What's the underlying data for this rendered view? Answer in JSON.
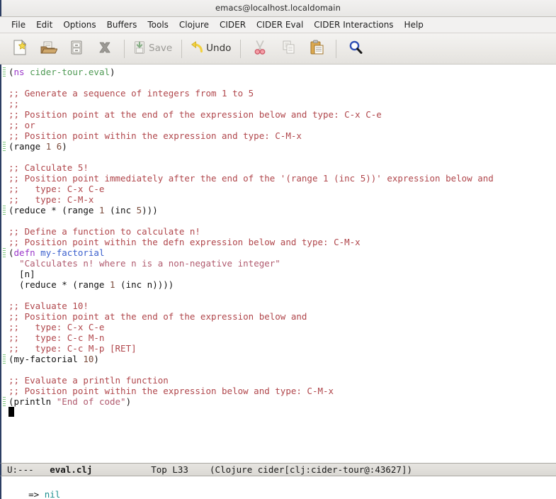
{
  "window": {
    "title": "emacs@localhost.localdomain"
  },
  "menubar": {
    "items": [
      {
        "label": "File"
      },
      {
        "label": "Edit"
      },
      {
        "label": "Options"
      },
      {
        "label": "Buffers"
      },
      {
        "label": "Tools"
      },
      {
        "label": "Clojure"
      },
      {
        "label": "CIDER"
      },
      {
        "label": "CIDER Eval"
      },
      {
        "label": "CIDER Interactions"
      },
      {
        "label": "Help"
      }
    ]
  },
  "toolbar": {
    "buttons": [
      {
        "icon": "new-file-icon",
        "label": "",
        "disabled": false
      },
      {
        "icon": "open-folder-icon",
        "label": "",
        "disabled": false
      },
      {
        "icon": "save-as-icon",
        "label": "",
        "disabled": false
      },
      {
        "icon": "close-file-icon",
        "label": "",
        "disabled": false
      },
      {
        "icon": "save-icon",
        "label": "Save",
        "disabled": true
      },
      {
        "icon": "undo-icon",
        "label": "Undo",
        "disabled": false
      },
      {
        "icon": "cut-icon",
        "label": "",
        "disabled": false
      },
      {
        "icon": "copy-icon",
        "label": "",
        "disabled": true
      },
      {
        "icon": "paste-icon",
        "label": "",
        "disabled": false
      },
      {
        "icon": "search-icon",
        "label": "",
        "disabled": false
      }
    ]
  },
  "editor": {
    "lines": [
      {
        "marked": true,
        "tokens": [
          {
            "t": "p",
            "v": "("
          },
          {
            "t": "kw",
            "v": "ns"
          },
          {
            "t": "p",
            "v": " "
          },
          {
            "t": "ns",
            "v": "cider-tour.eval"
          },
          {
            "t": "p",
            "v": ")"
          }
        ]
      },
      {
        "marked": false,
        "tokens": []
      },
      {
        "marked": false,
        "tokens": [
          {
            "t": "c",
            "v": ";; Generate a sequence of integers from 1 to 5"
          }
        ]
      },
      {
        "marked": false,
        "tokens": [
          {
            "t": "c",
            "v": ";;"
          }
        ]
      },
      {
        "marked": false,
        "tokens": [
          {
            "t": "c",
            "v": ";; Position point at the end of the expression below and type: C-x C-e"
          }
        ]
      },
      {
        "marked": false,
        "tokens": [
          {
            "t": "c",
            "v": ";; or"
          }
        ]
      },
      {
        "marked": false,
        "tokens": [
          {
            "t": "c",
            "v": ";; Position point within the expression and type: C-M-x"
          }
        ]
      },
      {
        "marked": true,
        "tokens": [
          {
            "t": "p",
            "v": "(range "
          },
          {
            "t": "n",
            "v": "1"
          },
          {
            "t": "p",
            "v": " "
          },
          {
            "t": "n",
            "v": "6"
          },
          {
            "t": "p",
            "v": ")"
          }
        ]
      },
      {
        "marked": false,
        "tokens": []
      },
      {
        "marked": false,
        "tokens": [
          {
            "t": "c",
            "v": ";; Calculate 5!"
          }
        ]
      },
      {
        "marked": false,
        "tokens": [
          {
            "t": "c",
            "v": ";; Position point immediately after the end of the '(range 1 (inc 5))' expression below and"
          }
        ]
      },
      {
        "marked": false,
        "tokens": [
          {
            "t": "c",
            "v": ";;   type: C-x C-e"
          }
        ]
      },
      {
        "marked": false,
        "tokens": [
          {
            "t": "c",
            "v": ";;   type: C-M-x"
          }
        ]
      },
      {
        "marked": true,
        "tokens": [
          {
            "t": "p",
            "v": "(reduce * (range "
          },
          {
            "t": "n",
            "v": "1"
          },
          {
            "t": "p",
            "v": " (inc "
          },
          {
            "t": "n",
            "v": "5"
          },
          {
            "t": "p",
            "v": ")))"
          }
        ]
      },
      {
        "marked": false,
        "tokens": []
      },
      {
        "marked": false,
        "tokens": [
          {
            "t": "c",
            "v": ";; Define a function to calculate n!"
          }
        ]
      },
      {
        "marked": false,
        "tokens": [
          {
            "t": "c",
            "v": ";; Position point within the defn expression below and type: C-M-x"
          }
        ]
      },
      {
        "marked": true,
        "tokens": [
          {
            "t": "p",
            "v": "("
          },
          {
            "t": "kw",
            "v": "defn"
          },
          {
            "t": "p",
            "v": " "
          },
          {
            "t": "f",
            "v": "my-factorial"
          }
        ]
      },
      {
        "marked": false,
        "tokens": [
          {
            "t": "p",
            "v": "  "
          },
          {
            "t": "s",
            "v": "\"Calculates n! where n is a non-negative integer\""
          }
        ]
      },
      {
        "marked": false,
        "tokens": [
          {
            "t": "p",
            "v": "  [n]"
          }
        ]
      },
      {
        "marked": false,
        "tokens": [
          {
            "t": "p",
            "v": "  (reduce * (range "
          },
          {
            "t": "n",
            "v": "1"
          },
          {
            "t": "p",
            "v": " (inc n))))"
          }
        ]
      },
      {
        "marked": false,
        "tokens": []
      },
      {
        "marked": false,
        "tokens": [
          {
            "t": "c",
            "v": ";; Evaluate 10!"
          }
        ]
      },
      {
        "marked": false,
        "tokens": [
          {
            "t": "c",
            "v": ";; Position point at the end of the expression below and"
          }
        ]
      },
      {
        "marked": false,
        "tokens": [
          {
            "t": "c",
            "v": ";;   type: C-x C-e"
          }
        ]
      },
      {
        "marked": false,
        "tokens": [
          {
            "t": "c",
            "v": ";;   type: C-c M-n"
          }
        ]
      },
      {
        "marked": false,
        "tokens": [
          {
            "t": "c",
            "v": ";;   type: C-c M-p [RET]"
          }
        ]
      },
      {
        "marked": true,
        "tokens": [
          {
            "t": "p",
            "v": "(my-factorial "
          },
          {
            "t": "n",
            "v": "10"
          },
          {
            "t": "p",
            "v": ")"
          }
        ]
      },
      {
        "marked": false,
        "tokens": []
      },
      {
        "marked": false,
        "tokens": [
          {
            "t": "c",
            "v": ";; Evaluate a println function"
          }
        ]
      },
      {
        "marked": false,
        "tokens": [
          {
            "t": "c",
            "v": ";; Position point within the expression below and type: C-M-x"
          }
        ]
      },
      {
        "marked": true,
        "tokens": [
          {
            "t": "p",
            "v": "(println "
          },
          {
            "t": "s",
            "v": "\"End of code\""
          },
          {
            "t": "p",
            "v": ")"
          }
        ]
      },
      {
        "marked": false,
        "cursor": true,
        "tokens": []
      }
    ]
  },
  "modeline": {
    "status": "U:---",
    "buffer": "eval.clj",
    "position": "Top L33",
    "mode": "(Clojure cider[clj:cider-tour@:43627])"
  },
  "echo": {
    "prompt": "=> ",
    "value": "nil"
  },
  "colors": {
    "comment": "#b0464b",
    "keyword": "#9a36c9",
    "namespace": "#4f9a54",
    "function_name": "#3a5fcd",
    "string": "#b05a6e",
    "number": "#7a4a3a",
    "nil_result": "#1d8f8f",
    "window_border": "#2c3e63",
    "fringe_marker": "#7ec67e"
  }
}
